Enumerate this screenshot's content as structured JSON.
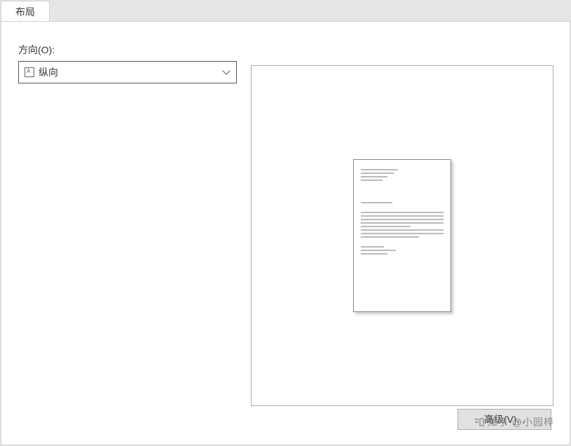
{
  "tabs": {
    "layout": "布局"
  },
  "orientation": {
    "label": "方向(O):",
    "value": "纵向"
  },
  "buttons": {
    "advanced": "高级(V)..."
  },
  "watermark": "知乎 @小园梓"
}
